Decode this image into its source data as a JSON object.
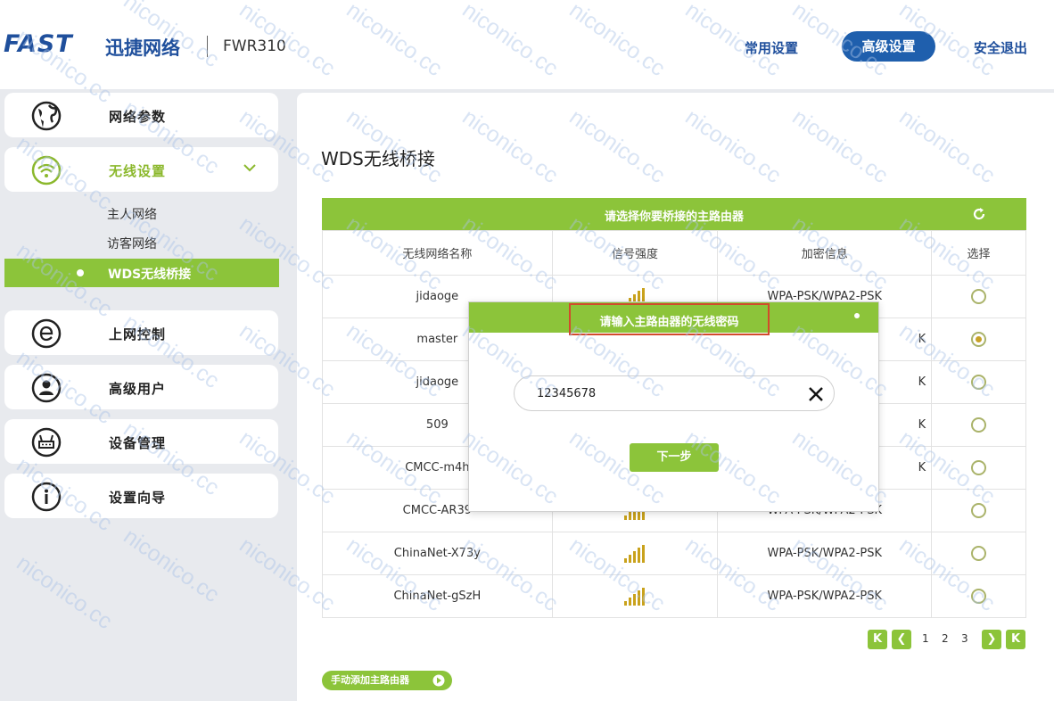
{
  "header": {
    "logo_text": "FAST",
    "logo_cn": "迅捷网络",
    "model": "FWR310",
    "nav": {
      "common": "常用设置",
      "advanced": "高级设置",
      "logout": "安全退出"
    }
  },
  "sidebar": {
    "items": [
      {
        "label": "网络参数",
        "icon": "globe-icon"
      },
      {
        "label": "无线设置",
        "icon": "wifi-icon"
      },
      {
        "label": "上网控制",
        "icon": "internet-e-icon"
      },
      {
        "label": "高级用户",
        "icon": "user-icon"
      },
      {
        "label": "设备管理",
        "icon": "router-icon"
      },
      {
        "label": "设置向导",
        "icon": "info-icon"
      }
    ],
    "wireless_sub": [
      "主人网络",
      "访客网络",
      "WDS无线桥接"
    ]
  },
  "main": {
    "title": "WDS无线桥接",
    "table_bar_title": "请选择你要桥接的主路由器",
    "columns": [
      "无线网络名称",
      "信号强度",
      "加密信息",
      "选择"
    ],
    "rows": [
      {
        "ssid": "jidaoge",
        "enc": "WPA-PSK/WPA2-PSK",
        "selected": false
      },
      {
        "ssid": "master",
        "enc": "K",
        "selected": true
      },
      {
        "ssid": "jidaoge",
        "enc": "K",
        "selected": false
      },
      {
        "ssid": "509",
        "enc": "K",
        "selected": false
      },
      {
        "ssid": "CMCC-m4h",
        "enc": "K",
        "selected": false
      },
      {
        "ssid": "CMCC-AR39",
        "enc": "WPA-PSK/WPA2-PSK",
        "selected": false
      },
      {
        "ssid": "ChinaNet-X73y",
        "enc": "WPA-PSK/WPA2-PSK",
        "selected": false
      },
      {
        "ssid": "ChinaNet-gSzH",
        "enc": "WPA-PSK/WPA2-PSK",
        "selected": false
      }
    ],
    "pager": {
      "pages": [
        "1",
        "2",
        "3"
      ]
    },
    "manual_add": "手动添加主路由器"
  },
  "dialog": {
    "title": "请输入主路由器的无线密码",
    "password": "12345678",
    "next": "下一步"
  },
  "watermark": "niconico.cc",
  "colors": {
    "accent_green": "#8cc43a",
    "brand_blue": "#1f4f9c",
    "highlight_red": "#d24a2c"
  }
}
